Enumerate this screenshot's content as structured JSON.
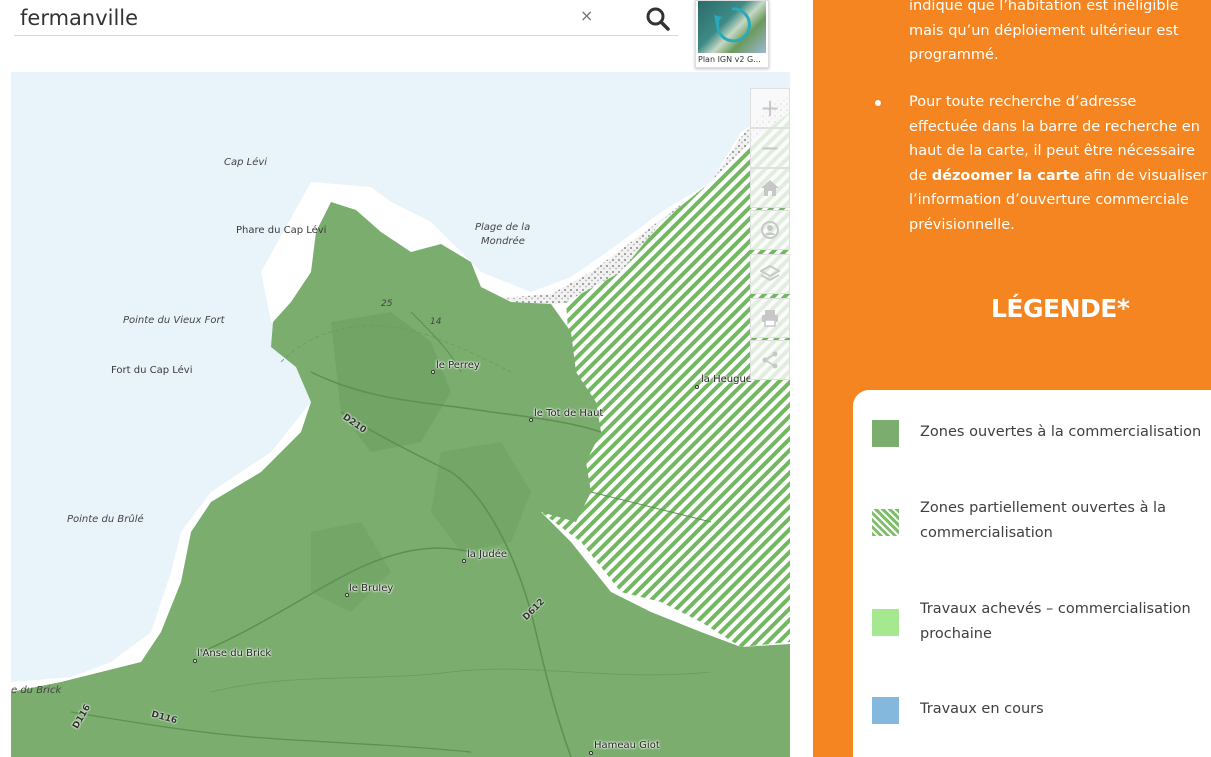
{
  "search": {
    "value": "fermanville",
    "clear_glyph": "×",
    "search_icon": "search-icon"
  },
  "basemap": {
    "label": "Plan IGN v2 G..."
  },
  "map": {
    "places": [
      {
        "name": "cap-levi",
        "text": "Cap Lévi",
        "style": "italic"
      },
      {
        "name": "phare-du-cap-levi",
        "text": "Phare du Cap Lévi",
        "style": "normal"
      },
      {
        "name": "plage-de-la",
        "text": "Plage de la",
        "style": "italic"
      },
      {
        "name": "mondree",
        "text": "Mondrée",
        "style": "italic"
      },
      {
        "name": "pointe-du-vieux-fort",
        "text": "Pointe du Vieux Fort",
        "style": "italic"
      },
      {
        "name": "fort-du-cap-levi",
        "text": "Fort du Cap Lévi",
        "style": "normal"
      },
      {
        "name": "le-perrey",
        "text": "le Perrey",
        "style": "town"
      },
      {
        "name": "le-tot-de-haut",
        "text": "le Tot de Haut",
        "style": "town"
      },
      {
        "name": "la-heugue",
        "text": "la Heugue",
        "style": "town"
      },
      {
        "name": "pointe-du-brule",
        "text": "Pointe du Brûlé",
        "style": "italic"
      },
      {
        "name": "la-judee",
        "text": "la Judée",
        "style": "town"
      },
      {
        "name": "le-bruley",
        "text": "le Bruley",
        "style": "town"
      },
      {
        "name": "lanse-du-brick",
        "text": "l'Anse du Brick",
        "style": "town"
      },
      {
        "name": "e-du-brick",
        "text": "e du Brick",
        "style": "italic"
      },
      {
        "name": "hameau-giot",
        "text": "Hameau Giot",
        "style": "town"
      }
    ],
    "roads": [
      "D210",
      "D612",
      "D116",
      "D116"
    ],
    "elevations": [
      "25",
      "14"
    ]
  },
  "toolbar": {
    "zoom_in": "+",
    "zoom_out": "−",
    "home_icon": "home-icon",
    "locate_icon": "locate-icon",
    "layers_icon": "layers-icon",
    "print_icon": "print-icon",
    "share_icon": "share-icon"
  },
  "panel": {
    "intro_line1": "indique que l’habitation est inéligible",
    "intro_line2": "mais qu’un déploiement ultérieur est",
    "intro_line3": "programmé.",
    "bullet_line1": "Pour toute recherche d’adresse",
    "bullet_line2": "effectuée dans la barre de recherche en",
    "bullet_line3": "haut de la carte, il peut être nécessaire",
    "bullet_line4_pre": "de ",
    "bullet_line4_bold": "dézoomer la carte",
    "bullet_line4_post": " afin de visualiser",
    "bullet_line5": "l’information d’ouverture commerciale",
    "bullet_line6": "prévisionnelle.",
    "legend_title": "LÉGENDE*"
  },
  "legend": [
    {
      "line1": "Zones ouvertes à la commercialisation",
      "line2": "",
      "color": "#7aad6e",
      "pattern": "solid"
    },
    {
      "line1": "Zones partiellement ouvertes à la",
      "line2": "commercialisation",
      "color": "#7fbf6a",
      "pattern": "hatched"
    },
    {
      "line1": "Travaux achevés – commercialisation",
      "line2": "prochaine",
      "color": "#a6e88f",
      "pattern": "solid"
    },
    {
      "line1": "Travaux en cours",
      "line2": "",
      "color": "#84b8dc",
      "pattern": "solid"
    }
  ],
  "colors": {
    "panel_orange": "#f58520",
    "map_sea": "#e9f3fa",
    "zone_green": "#7aad6e"
  }
}
